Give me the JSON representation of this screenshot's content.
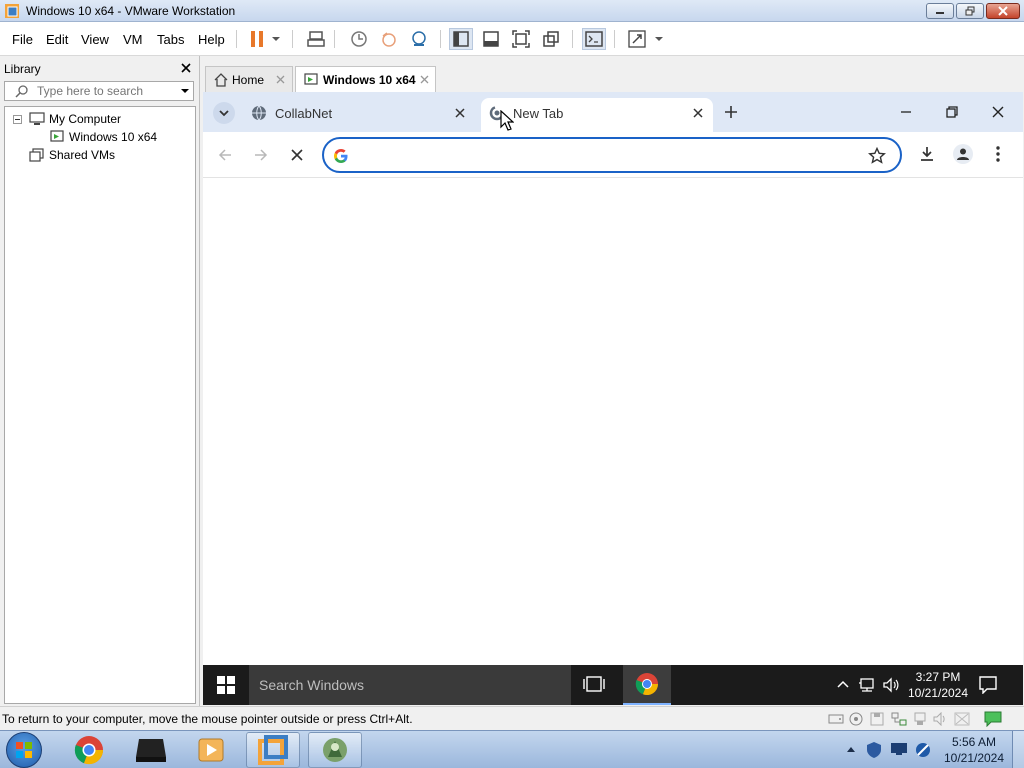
{
  "window": {
    "title": "Windows 10 x64 - VMware Workstation"
  },
  "menu": {
    "items": [
      "File",
      "Edit",
      "View",
      "VM",
      "Tabs",
      "Help"
    ]
  },
  "library": {
    "header": "Library",
    "search_placeholder": "Type here to search",
    "tree": {
      "my_computer": "My Computer",
      "vm": "Windows 10 x64",
      "shared": "Shared VMs"
    }
  },
  "vm_tabs": [
    {
      "label": "Home"
    },
    {
      "label": "Windows 10 x64"
    }
  ],
  "chrome": {
    "tabs": [
      {
        "label": "CollabNet"
      },
      {
        "label": "New Tab"
      }
    ],
    "omnibox_value": ""
  },
  "guest_taskbar": {
    "search": "Search Windows",
    "time": "3:27 PM",
    "date": "10/21/2024"
  },
  "statusbar": {
    "message": "To return to your computer, move the mouse pointer outside or press Ctrl+Alt."
  },
  "host_taskbar": {
    "time": "5:56 AM",
    "date": "10/21/2024"
  },
  "colors": {
    "accent": "#1a62c7",
    "pause": "#e8782a",
    "guest_taskbar": "#1b1b1b"
  }
}
